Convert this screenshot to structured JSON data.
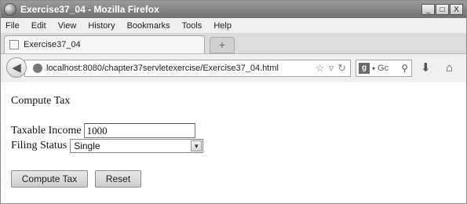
{
  "window": {
    "title": "Exercise37_04 - Mozilla Firefox",
    "buttons": {
      "minimize": "_",
      "maximize": "□",
      "close": "X"
    }
  },
  "menu": [
    "File",
    "Edit",
    "View",
    "History",
    "Bookmarks",
    "Tools",
    "Help"
  ],
  "tab": {
    "title": "Exercise37_04",
    "new_tab": "+"
  },
  "nav": {
    "url": "localhost:8080/chapter37servletexercise/Exercise37_04.html",
    "search_placeholder": "Gc"
  },
  "page": {
    "heading": "Compute Tax",
    "income_label": "Taxable Income",
    "income_value": "1000",
    "status_label": "Filing Status",
    "status_value": "Single",
    "compute_button": "Compute Tax",
    "reset_button": "Reset"
  }
}
